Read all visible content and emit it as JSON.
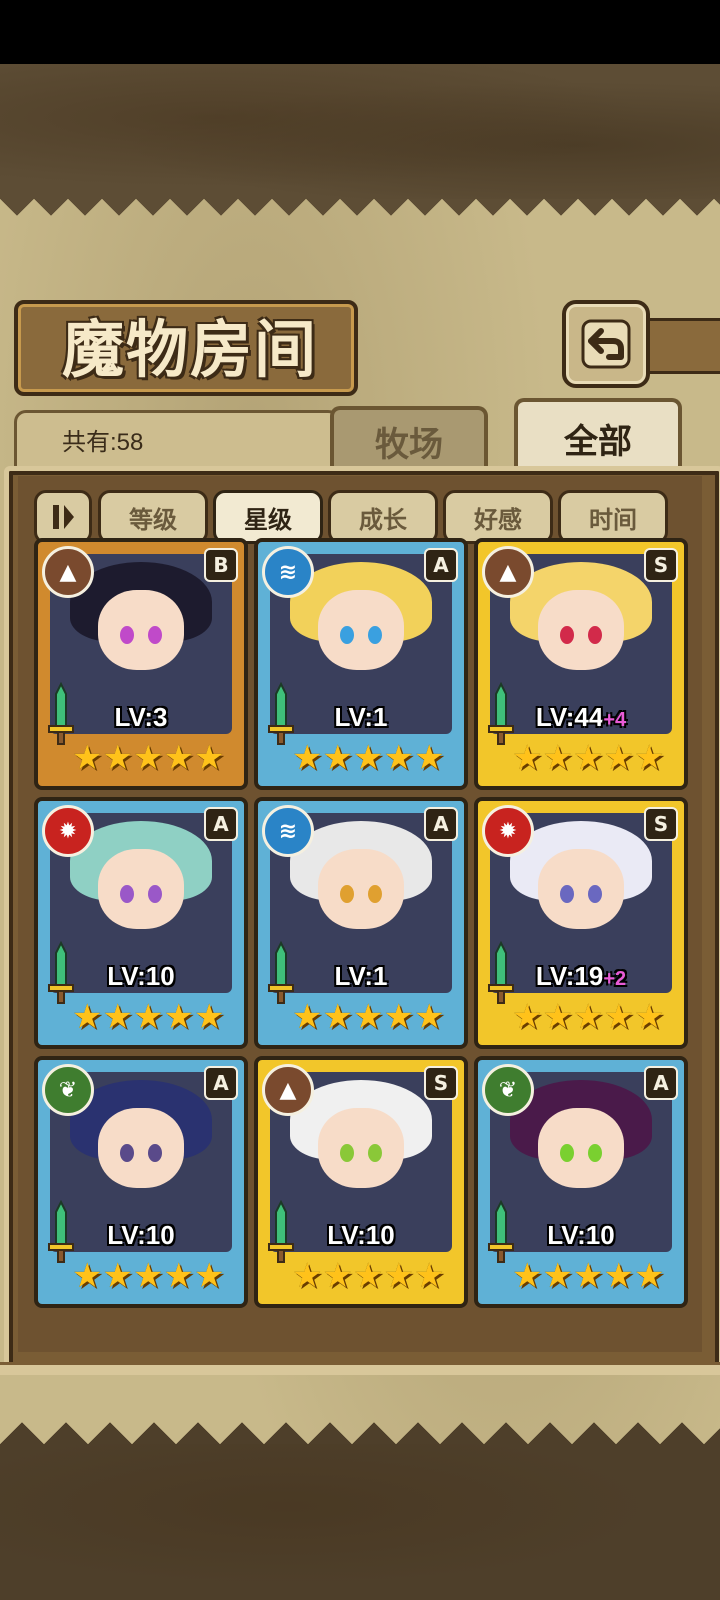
{
  "title": "魔物房间",
  "count_label": "共有:58",
  "tabs": [
    "牧场",
    "全部"
  ],
  "active_tab": "全部",
  "sort_buttons": [
    "等级",
    "星级",
    "成长",
    "好感",
    "时间"
  ],
  "active_sort": "星级",
  "icons": {
    "back": "back-arrow-icon",
    "sort_order": "sort-order-icon",
    "sword": "sword-icon",
    "star": "star-icon"
  },
  "colors": {
    "bronze_frame": "#d08a2e",
    "blue_frame": "#5fb1d6",
    "gold_frame": "#f2c62a",
    "earth_element": "#7a4a2e",
    "water_element": "#2a84c7",
    "fire_element": "#c8231f",
    "wind_element": "#3f7d2f",
    "level_bonus": "#e85bd6"
  },
  "cards": [
    {
      "rank": "B",
      "element": "earth",
      "element_icon": "mountain-icon",
      "level": "LV:3",
      "bonus": "",
      "stars": 5
    },
    {
      "rank": "A",
      "element": "water",
      "element_icon": "wave-icon",
      "level": "LV:1",
      "bonus": "",
      "stars": 5
    },
    {
      "rank": "S",
      "element": "earth",
      "element_icon": "mountain-icon",
      "level": "LV:44",
      "bonus": "+4",
      "stars": 5
    },
    {
      "rank": "A",
      "element": "fire",
      "element_icon": "flame-icon",
      "level": "LV:10",
      "bonus": "",
      "stars": 5
    },
    {
      "rank": "A",
      "element": "water",
      "element_icon": "wave-icon",
      "level": "LV:1",
      "bonus": "",
      "stars": 5
    },
    {
      "rank": "S",
      "element": "fire",
      "element_icon": "flame-icon",
      "level": "LV:19",
      "bonus": "+2",
      "stars": 5
    },
    {
      "rank": "A",
      "element": "wind",
      "element_icon": "leaf-icon",
      "level": "LV:10",
      "bonus": "",
      "stars": 5
    },
    {
      "rank": "S",
      "element": "earth",
      "element_icon": "mountain-icon",
      "level": "LV:10",
      "bonus": "",
      "stars": 5
    },
    {
      "rank": "A",
      "element": "wind",
      "element_icon": "leaf-icon",
      "level": "LV:10",
      "bonus": "",
      "stars": 5
    }
  ]
}
